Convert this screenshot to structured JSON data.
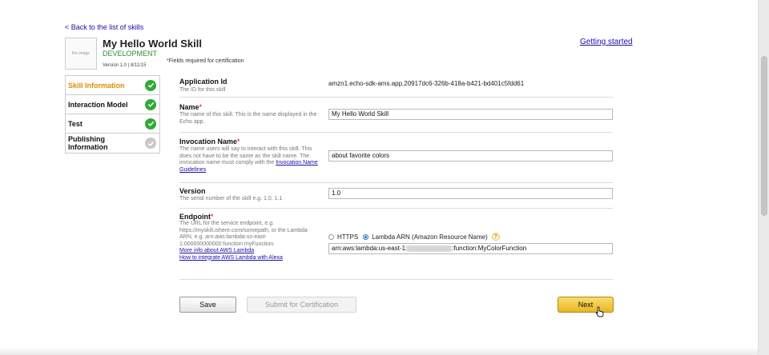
{
  "nav": {
    "back_link": "< Back to the list of skills",
    "getting_started": "Getting started"
  },
  "skill": {
    "logo_text": "fire image",
    "title": "My Hello World Skill",
    "status": "DEVELOPMENT",
    "version_line": "Version 1.0 | 8/11/15",
    "required_note": "Fields required for certification"
  },
  "sidebar": {
    "items": [
      {
        "label": "Skill Information",
        "state": "complete"
      },
      {
        "label": "Interaction Model",
        "state": "complete"
      },
      {
        "label": "Test",
        "state": "complete"
      },
      {
        "label": "Publishing Information",
        "state": "incomplete"
      }
    ]
  },
  "form": {
    "app_id": {
      "label": "Application Id",
      "help": "The ID for this skill",
      "value": "amzn1.echo-sdk-ams.app.20917dc6-326b-418a-b421-bd401c5fdd61"
    },
    "name": {
      "label": "Name",
      "help": "The name of this skill. This is the name displayed in the Echo app.",
      "value": "My Hello World Skill"
    },
    "invocation": {
      "label": "Invocation Name",
      "help": "The name users will say to interact with this skill. This does not have to be the same as the skill name. The invocation name must comply with the",
      "link": "Invocation Name Guidelines",
      "value": "about favorite colors"
    },
    "version": {
      "label": "Version",
      "help": "The serial number of the skill e.g. 1.0, 1.1",
      "value": "1.0"
    },
    "endpoint": {
      "label": "Endpoint",
      "help": "The URL for the service endpoint, e.g. https://myskill.ishere.com/somepath, or the Lambda ARN, e.g. arn:aws:lambda:us-east-1:000000000000:function:myFunction.",
      "link1": "More info about AWS Lambda",
      "link2": "How to integrate AWS Lambda with Alexa",
      "option_https": "HTTPS",
      "option_lambda": "Lambda ARN (Amazon Resource Name)",
      "help_icon": "?",
      "value_prefix": "arn:aws:lambda:us-east-1:",
      "value_suffix": ":function:MyColorFunction"
    },
    "required_mark": "*"
  },
  "buttons": {
    "save": "Save",
    "submit": "Submit for Certification",
    "next": "Next"
  },
  "colors": {
    "accent": "#e28a00",
    "check_green": "#2eab34",
    "next_button": "#f0c243",
    "link": "#1a0dab"
  }
}
